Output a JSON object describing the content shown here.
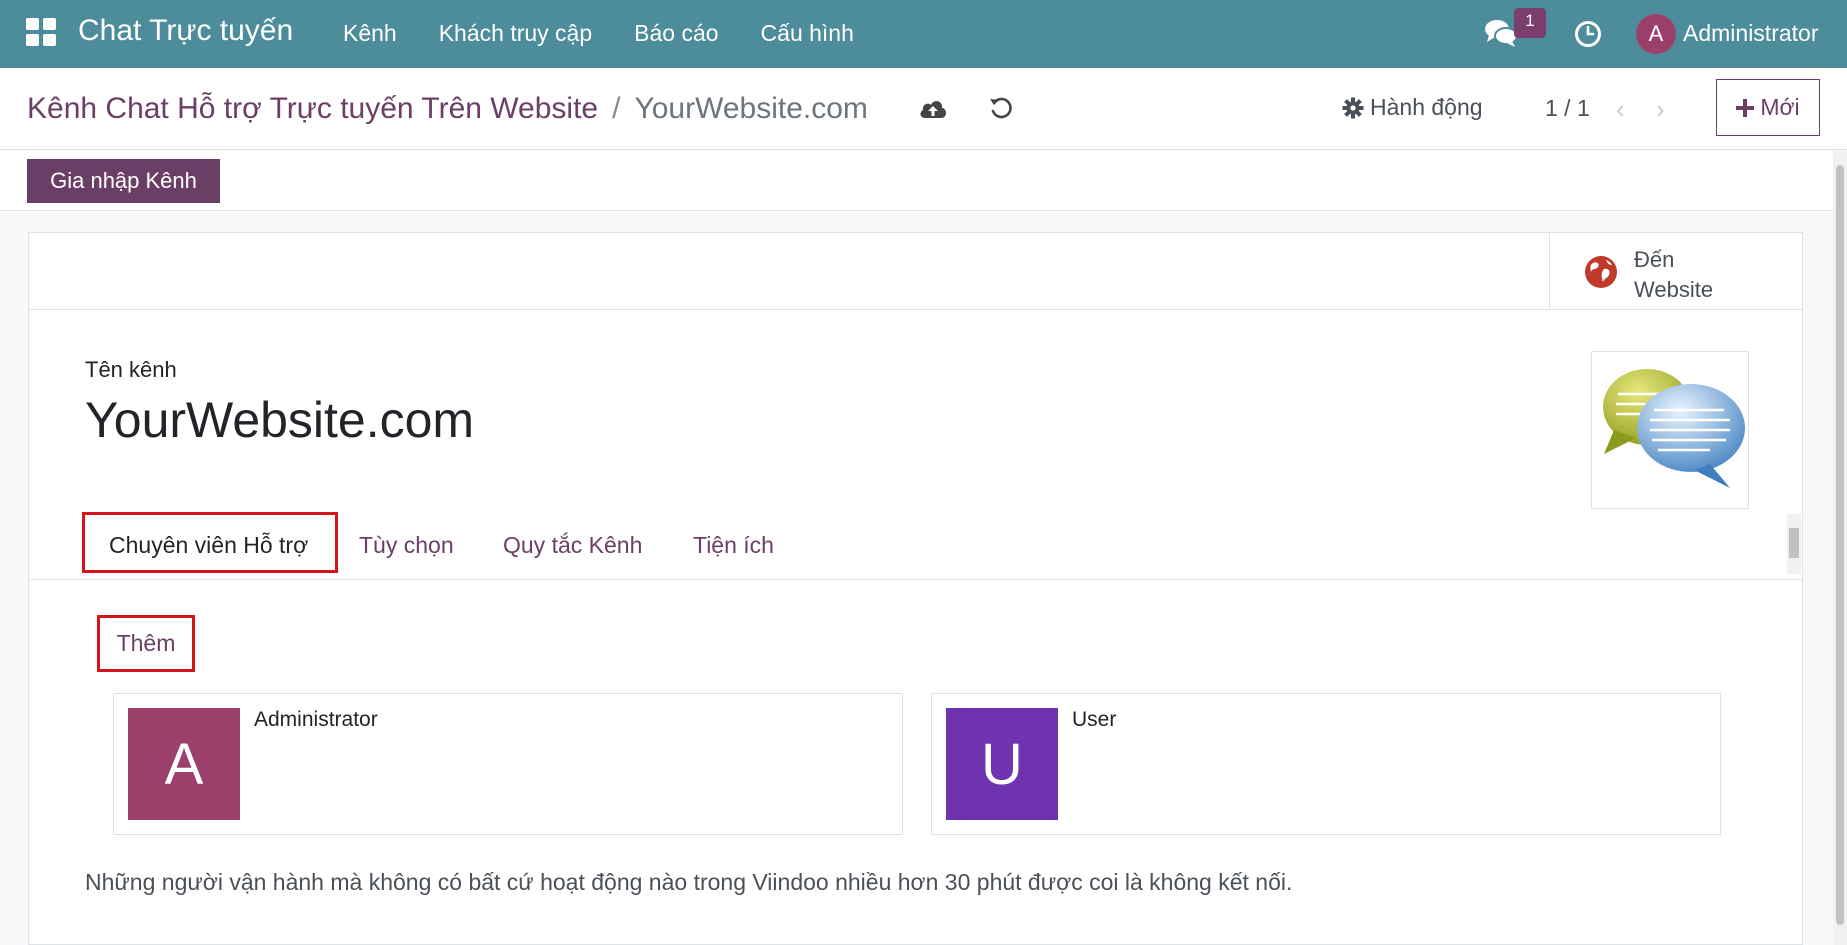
{
  "navbar": {
    "brand": "Chat Trực tuyến",
    "menu": [
      "Kênh",
      "Khách truy cập",
      "Báo cáo",
      "Cấu hình"
    ],
    "message_count": "1",
    "user_initial": "A",
    "user_name": "Administrator"
  },
  "control": {
    "breadcrumb_parent": "Kênh Chat Hỗ trợ Trực tuyến Trên Website",
    "breadcrumb_sep": "/",
    "breadcrumb_current": "YourWebsite.com",
    "action_label": "Hành động",
    "pager": "1 / 1",
    "new_label": "Mới"
  },
  "statusbar": {
    "join_label": "Gia nhập Kênh"
  },
  "sheet": {
    "website_button": [
      "Đến",
      "Website"
    ],
    "field_label": "Tên kênh",
    "channel_name": "YourWebsite.com",
    "tabs": [
      "Chuyên viên Hỗ trợ",
      "Tùy chọn",
      "Quy tắc Kênh",
      "Tiện ích"
    ],
    "add_label": "Thêm",
    "operators": [
      {
        "initial": "A",
        "name": "Administrator",
        "color": "#9b3f6b"
      },
      {
        "initial": "U",
        "name": "User",
        "color": "#6f33b0"
      }
    ],
    "note": "Những người vận hành mà không có bất cứ hoạt động nào trong Viindoo nhiều hơn 30 phút được coi là không kết nối."
  },
  "colors": {
    "navbar": "#4c8c9b",
    "primary": "#6b3e66",
    "highlight": "#d8141b"
  }
}
